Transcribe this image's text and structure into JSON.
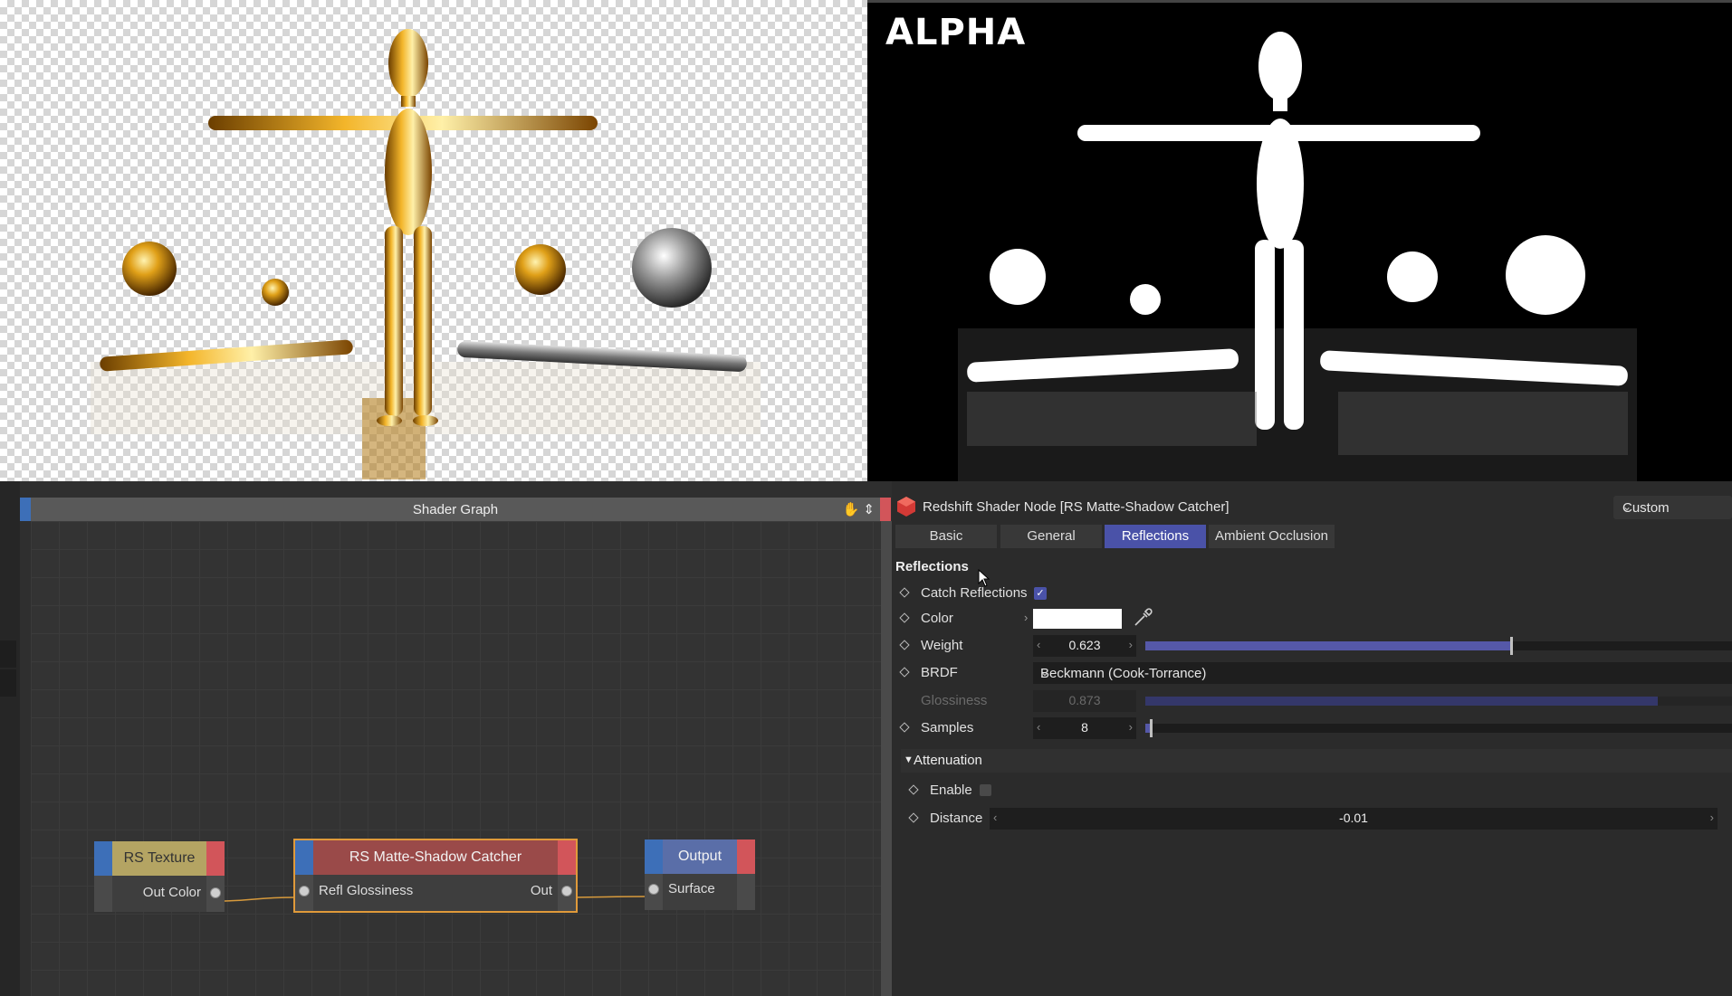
{
  "render": {
    "alpha_label": "ALPHA"
  },
  "shader_graph": {
    "title": "Shader Graph",
    "tools_icons": [
      "hand-icon",
      "move-vertical-icon"
    ],
    "nodes": {
      "rs_texture": {
        "title": "RS Texture",
        "outputs": [
          "Out Color"
        ],
        "header_color": "#b4a463"
      },
      "matte_shadow": {
        "title": "RS Matte-Shadow Catcher",
        "inputs": [
          "Refl Glossiness"
        ],
        "outputs": [
          "Out"
        ],
        "header_color": "#9a4a49",
        "selected_border": "#e09a3a"
      },
      "output": {
        "title": "Output",
        "inputs": [
          "Surface"
        ],
        "header_color": "#5a6ea8"
      }
    }
  },
  "attributes": {
    "title": "Redshift Shader Node [RS Matte-Shadow Catcher]",
    "preset": "Custom",
    "tabs": [
      {
        "label": "Basic",
        "active": false
      },
      {
        "label": "General",
        "active": false
      },
      {
        "label": "Reflections",
        "active": true
      },
      {
        "label": "Ambient Occlusion",
        "active": false
      }
    ],
    "section": "Reflections",
    "catch_reflections": {
      "label": "Catch Reflections",
      "checked": true
    },
    "color": {
      "label": "Color",
      "value": "#ffffff"
    },
    "weight": {
      "label": "Weight",
      "value": "0.623",
      "fraction": 0.623
    },
    "brdf": {
      "label": "BRDF",
      "value": "Beckmann (Cook-Torrance)"
    },
    "glossiness": {
      "label": "Glossiness",
      "value": "0.873",
      "fraction": 0.873,
      "disabled": true
    },
    "samples": {
      "label": "Samples",
      "value": "8",
      "fraction": 0.008
    },
    "attenuation": {
      "title": "Attenuation",
      "enable": {
        "label": "Enable",
        "checked": false
      },
      "distance": {
        "label": "Distance",
        "value": "-0.01"
      }
    }
  },
  "colors": {
    "accent": "#4a52a8",
    "port_blue": "#3d6fb8",
    "port_red": "#d2555a",
    "wire": "#d79a3c"
  }
}
